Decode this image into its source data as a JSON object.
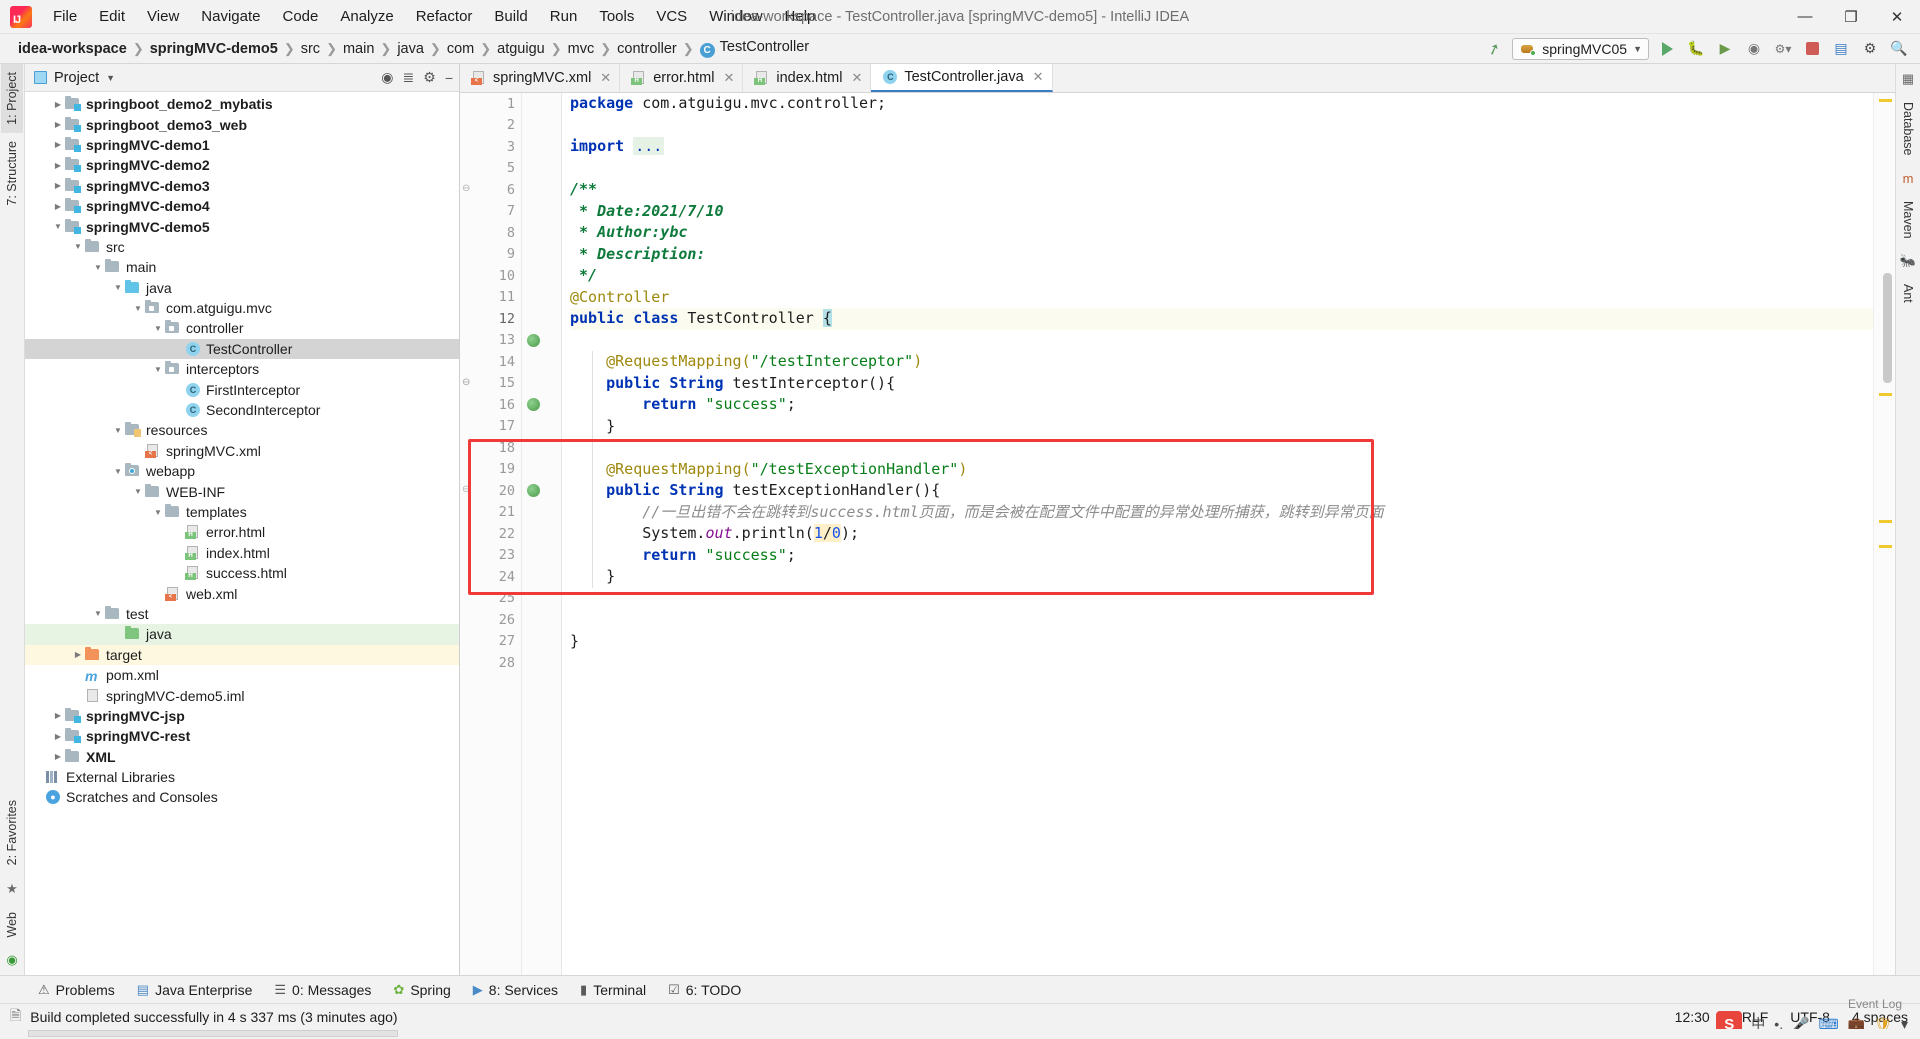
{
  "window": {
    "title": "idea-workspace - TestController.java [springMVC-demo5] - IntelliJ IDEA",
    "minimize": "—",
    "maximize": "❐",
    "close": "✕"
  },
  "menu": [
    {
      "label": "File"
    },
    {
      "label": "Edit"
    },
    {
      "label": "View"
    },
    {
      "label": "Navigate"
    },
    {
      "label": "Code"
    },
    {
      "label": "Analyze"
    },
    {
      "label": "Refactor"
    },
    {
      "label": "Build"
    },
    {
      "label": "Run"
    },
    {
      "label": "Tools"
    },
    {
      "label": "VCS"
    },
    {
      "label": "Window"
    },
    {
      "label": "Help"
    }
  ],
  "breadcrumbs": [
    {
      "label": "idea-workspace",
      "bold": true
    },
    {
      "label": "springMVC-demo5",
      "bold": true
    },
    {
      "label": "src",
      "bold": false
    },
    {
      "label": "main",
      "bold": false
    },
    {
      "label": "java",
      "bold": false
    },
    {
      "label": "com",
      "bold": false
    },
    {
      "label": "atguigu",
      "bold": false
    },
    {
      "label": "mvc",
      "bold": false
    },
    {
      "label": "controller",
      "bold": false
    },
    {
      "label": "TestController",
      "bold": false,
      "icon": "C"
    }
  ],
  "toolbar": {
    "run_config": "springMVC05",
    "build_hammer": "build-icon",
    "run": "run-icon",
    "debug": "debug-icon",
    "run_coverage": "coverage-icon",
    "profile": "profile-icon",
    "attach": "attach-icon",
    "stop": "stop-icon",
    "updates": "update-icon",
    "settings": "settings-icon",
    "search": "search-icon"
  },
  "left_rail": [
    {
      "label": "1: Project",
      "selected": true
    },
    {
      "label": "7: Structure",
      "selected": false
    },
    {
      "label": "2: Favorites",
      "selected": false
    },
    {
      "label": "Web",
      "selected": false
    }
  ],
  "right_rail": [
    {
      "label": "Database"
    },
    {
      "label": "Maven"
    },
    {
      "label": "Ant"
    }
  ],
  "project_panel": {
    "title": "Project",
    "tree": [
      {
        "indent": 1,
        "arrow": "right",
        "icon": "module",
        "label": "springboot_demo2_mybatis",
        "bold": true,
        "state": ""
      },
      {
        "indent": 1,
        "arrow": "right",
        "icon": "module",
        "label": "springboot_demo3_web",
        "bold": true,
        "state": ""
      },
      {
        "indent": 1,
        "arrow": "right",
        "icon": "module",
        "label": "springMVC-demo1",
        "bold": true,
        "state": ""
      },
      {
        "indent": 1,
        "arrow": "right",
        "icon": "module",
        "label": "springMVC-demo2",
        "bold": true,
        "state": ""
      },
      {
        "indent": 1,
        "arrow": "right",
        "icon": "module",
        "label": "springMVC-demo3",
        "bold": true,
        "state": ""
      },
      {
        "indent": 1,
        "arrow": "right",
        "icon": "module",
        "label": "springMVC-demo4",
        "bold": true,
        "state": ""
      },
      {
        "indent": 1,
        "arrow": "down",
        "icon": "module",
        "label": "springMVC-demo5",
        "bold": true,
        "state": ""
      },
      {
        "indent": 2,
        "arrow": "down",
        "icon": "folder",
        "label": "src",
        "bold": false,
        "state": ""
      },
      {
        "indent": 3,
        "arrow": "down",
        "icon": "folder",
        "label": "main",
        "bold": false,
        "state": ""
      },
      {
        "indent": 4,
        "arrow": "down",
        "icon": "source",
        "label": "java",
        "bold": false,
        "state": ""
      },
      {
        "indent": 5,
        "arrow": "down",
        "icon": "package",
        "label": "com.atguigu.mvc",
        "bold": false,
        "state": ""
      },
      {
        "indent": 6,
        "arrow": "down",
        "icon": "package",
        "label": "controller",
        "bold": false,
        "state": ""
      },
      {
        "indent": 7,
        "arrow": "none",
        "icon": "class",
        "label": "TestController",
        "bold": false,
        "state": "selected"
      },
      {
        "indent": 6,
        "arrow": "down",
        "icon": "package",
        "label": "interceptors",
        "bold": false,
        "state": ""
      },
      {
        "indent": 7,
        "arrow": "none",
        "icon": "class",
        "label": "FirstInterceptor",
        "bold": false,
        "state": ""
      },
      {
        "indent": 7,
        "arrow": "none",
        "icon": "class",
        "label": "SecondInterceptor",
        "bold": false,
        "state": ""
      },
      {
        "indent": 4,
        "arrow": "down",
        "icon": "resources",
        "label": "resources",
        "bold": false,
        "state": ""
      },
      {
        "indent": 5,
        "arrow": "none",
        "icon": "xml-spring",
        "label": "springMVC.xml",
        "bold": false,
        "state": ""
      },
      {
        "indent": 4,
        "arrow": "down",
        "icon": "webapp",
        "label": "webapp",
        "bold": false,
        "state": ""
      },
      {
        "indent": 5,
        "arrow": "down",
        "icon": "folder",
        "label": "WEB-INF",
        "bold": false,
        "state": ""
      },
      {
        "indent": 6,
        "arrow": "down",
        "icon": "folder",
        "label": "templates",
        "bold": false,
        "state": ""
      },
      {
        "indent": 7,
        "arrow": "none",
        "icon": "html",
        "label": "error.html",
        "bold": false,
        "state": ""
      },
      {
        "indent": 7,
        "arrow": "none",
        "icon": "html",
        "label": "index.html",
        "bold": false,
        "state": ""
      },
      {
        "indent": 7,
        "arrow": "none",
        "icon": "html",
        "label": "success.html",
        "bold": false,
        "state": ""
      },
      {
        "indent": 6,
        "arrow": "none",
        "icon": "xml-web",
        "label": "web.xml",
        "bold": false,
        "state": ""
      },
      {
        "indent": 3,
        "arrow": "down",
        "icon": "folder",
        "label": "test",
        "bold": false,
        "state": ""
      },
      {
        "indent": 4,
        "arrow": "none",
        "icon": "test",
        "label": "java",
        "bold": false,
        "state": "green"
      },
      {
        "indent": 2,
        "arrow": "right",
        "icon": "target",
        "label": "target",
        "bold": false,
        "state": "yellow"
      },
      {
        "indent": 2,
        "arrow": "none",
        "icon": "maven",
        "label": "pom.xml",
        "bold": false,
        "state": ""
      },
      {
        "indent": 2,
        "arrow": "none",
        "icon": "iml",
        "label": "springMVC-demo5.iml",
        "bold": false,
        "state": ""
      },
      {
        "indent": 1,
        "arrow": "right",
        "icon": "module",
        "label": "springMVC-jsp",
        "bold": true,
        "state": ""
      },
      {
        "indent": 1,
        "arrow": "right",
        "icon": "module",
        "label": "springMVC-rest",
        "bold": true,
        "state": ""
      },
      {
        "indent": 1,
        "arrow": "right",
        "icon": "folder",
        "label": "XML",
        "bold": true,
        "state": ""
      },
      {
        "indent": 0,
        "arrow": "none",
        "icon": "library",
        "label": "External Libraries",
        "bold": false,
        "state": ""
      },
      {
        "indent": 0,
        "arrow": "none",
        "icon": "scratch",
        "label": "Scratches and Consoles",
        "bold": false,
        "state": ""
      }
    ]
  },
  "editor": {
    "tabs": [
      {
        "label": "springMVC.xml",
        "icon": "xml-spring",
        "active": false
      },
      {
        "label": "error.html",
        "icon": "html",
        "active": false
      },
      {
        "label": "index.html",
        "icon": "html",
        "active": false
      },
      {
        "label": "TestController.java",
        "icon": "class",
        "active": true
      }
    ],
    "line_numbers": [
      "1",
      "2",
      "3",
      "5",
      "6",
      "7",
      "8",
      "9",
      "10",
      "11",
      "12",
      "13",
      "14",
      "15",
      "16",
      "17",
      "18",
      "19",
      "20",
      "21",
      "22",
      "23",
      "24",
      "25",
      "26",
      "27",
      "28"
    ],
    "code_lines": [
      "package com.atguigu.mvc.controller;",
      "",
      "import ...",
      "",
      "/**",
      " * Date:2021/7/10",
      " * Author:ybc",
      " * Description:",
      " */",
      "@Controller",
      "public class TestController {",
      "",
      "    @RequestMapping(\"/testInterceptor\")",
      "    public String testInterceptor(){",
      "        return \"success\";",
      "    }",
      "",
      "    @RequestMapping(\"/testExceptionHandler\")",
      "    public String testExceptionHandler(){",
      "        //一旦出错不会在跳转到success.html页面，而是会被在配置文件中配置的异常处理所捕获，跳转到异常页面",
      "        System.out.println(1/0);",
      "        return \"success\";",
      "    }",
      "",
      "",
      "}",
      ""
    ]
  },
  "bottom_tabs": [
    {
      "label": "Problems",
      "icon": "warning-icon"
    },
    {
      "label": "Java Enterprise",
      "icon": "java-icon"
    },
    {
      "label": "0: Messages",
      "icon": "messages-icon"
    },
    {
      "label": "Spring",
      "icon": "spring-icon"
    },
    {
      "label": "8: Services",
      "icon": "services-icon"
    },
    {
      "label": "Terminal",
      "icon": "terminal-icon"
    },
    {
      "label": "6: TODO",
      "icon": "todo-icon"
    },
    {
      "label": "Event Log",
      "icon": "event-log-icon"
    }
  ],
  "status": {
    "message": "Build completed successfully in 4 s 337 ms (3 minutes ago)",
    "time": "12:30",
    "line_sep": "CRLF",
    "encoding": "UTF-8",
    "indent": "4 spaces"
  },
  "tray": {
    "ime": "中",
    "items": [
      "sogou-icon",
      "ime-chinese",
      "comma-icon",
      "mic-icon",
      "keyboard-icon",
      "toolbox-icon",
      "shield-icon",
      "more-icon"
    ]
  },
  "colors": {
    "accent": "#3a7cc4",
    "red_box": "#f03a3a",
    "keyword": "#0033b3",
    "string": "#067d17",
    "annotation": "#9e880d",
    "javadoc": "#0e7a3c",
    "selection": "#d4d4d4",
    "green_row": "#e7f4e4",
    "yellow_row": "#fdf8df"
  }
}
